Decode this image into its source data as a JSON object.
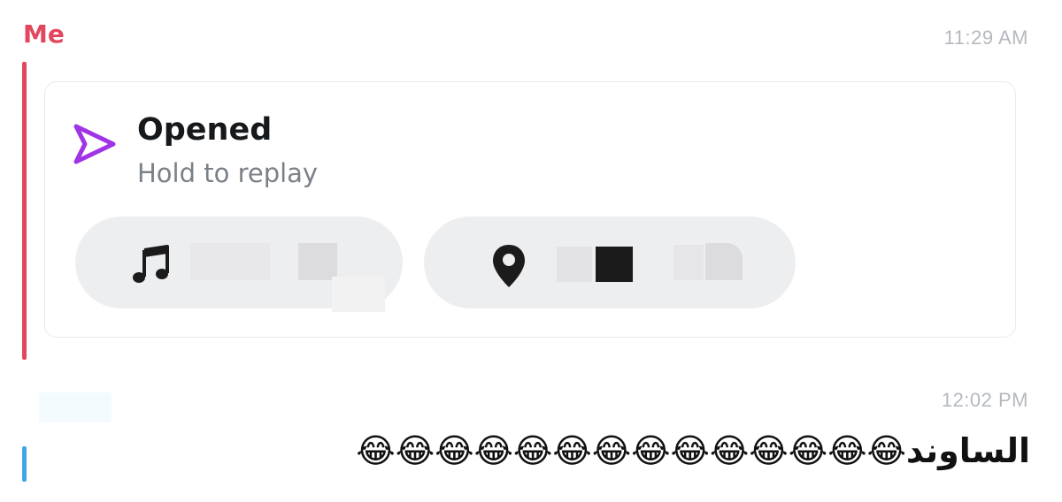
{
  "message1": {
    "sender": "Me",
    "time": "11:29 AM",
    "snap": {
      "title": "Opened",
      "subtitle": "Hold to replay",
      "icon": "sent-snap-arrow-icon",
      "accent_color": "#a033e6",
      "attachments": [
        {
          "type": "music",
          "icon": "music-note-icon"
        },
        {
          "type": "location",
          "icon": "location-pin-icon"
        }
      ]
    }
  },
  "message2": {
    "time": "12:02 PM",
    "text": "الساوند😂😂😂😂😂😂😂😂😂😂😂😂😂😂"
  },
  "colors": {
    "sender_red": "#e2475e",
    "thread_blue": "#3ea6e2",
    "timestamp_gray": "#b5b9bf"
  }
}
